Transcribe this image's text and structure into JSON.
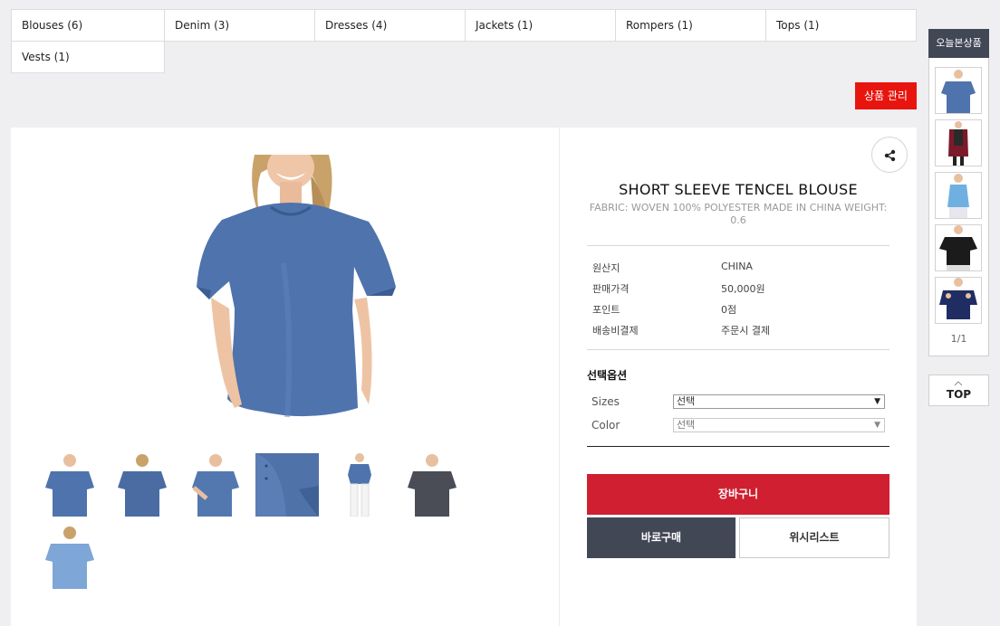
{
  "categories": [
    "Blouses (6)",
    "Denim (3)",
    "Dresses (4)",
    "Jackets (1)",
    "Rompers (1)",
    "Tops (1)",
    "Vests (1)"
  ],
  "admin_button": "상품 관리",
  "product": {
    "title": "SHORT SLEEVE TENCEL BLOUSE",
    "summary": "FABRIC: WOVEN 100% POLYESTER MADE IN CHINA WEIGHT: 0.6",
    "specs": [
      {
        "label": "원산지",
        "value": "CHINA"
      },
      {
        "label": "판매가격",
        "value": "50,000원"
      },
      {
        "label": "포인트",
        "value": "0점"
      },
      {
        "label": "배송비결제",
        "value": "주문시 결제"
      }
    ],
    "options_heading": "선택옵션",
    "options": [
      {
        "label": "Sizes",
        "selected": "선택"
      },
      {
        "label": "Color",
        "selected": "선택"
      }
    ],
    "buttons": {
      "cart": "장바구니",
      "buy": "바로구매",
      "wishlist": "위시리스트"
    }
  },
  "recent": {
    "heading": "오늘본상품",
    "page": "1/1"
  },
  "top_button": "TOP",
  "icons": {
    "share": "share-icon",
    "select_arrow": "triangle-down-icon",
    "top_caret": "chevron-up-icon"
  },
  "colors": {
    "accent_red": "#cf1f30",
    "admin_red": "#e8150e",
    "dark_slate": "#424755"
  }
}
